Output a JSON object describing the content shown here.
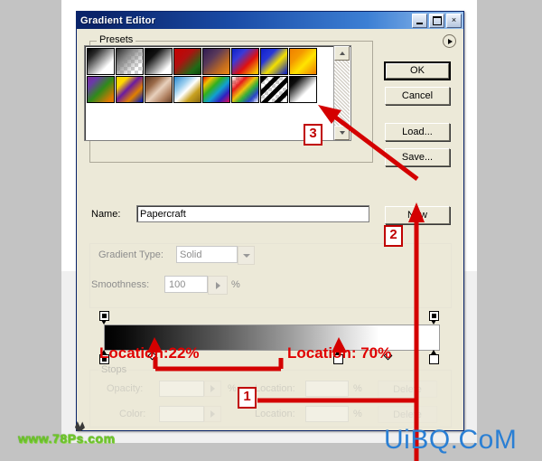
{
  "window": {
    "title": "Gradient Editor",
    "controls": {
      "minimize": "minimize-button",
      "maximize": "maximize-button",
      "close": "×"
    }
  },
  "presets": {
    "legend": "Presets",
    "menu_icon": "preset-menu-arrow-icon",
    "scroll_up": "scroll-up-arrow",
    "scroll_down": "scroll-down-arrow",
    "rows": [
      [
        {
          "name": "foreground-to-background",
          "css": "linear-gradient(135deg,#000000 0%,#2a2a2a 22%,#ffffff 72%,#ffffff 100%)",
          "checker": false
        },
        {
          "name": "foreground-to-transparent",
          "css": "linear-gradient(135deg,#2b2b2b 0%,#8a8a8a 35%,rgba(255,255,255,0) 78%)",
          "checker": true
        },
        {
          "name": "black-white",
          "css": "linear-gradient(135deg,#000000 0%,#111111 28%,#ffffff 80%,#ffffff 100%)",
          "checker": false
        },
        {
          "name": "red-green",
          "css": "linear-gradient(135deg,#c80000 0%,#b01010 38%,#1f6b16 78%,#0d4a0c 100%)",
          "checker": false
        },
        {
          "name": "violet-orange",
          "css": "linear-gradient(135deg,#2e1a52 0%,#5a3a5a 35%,#c06a20 72%,#f08a12 100%)",
          "checker": false
        },
        {
          "name": "blue-red-yellow",
          "css": "linear-gradient(135deg,#0a22c8 0%,#3a3ad8 28%,#e01010 60%,#f5c000 92%)",
          "checker": false
        },
        {
          "name": "blue-yellow-blue",
          "css": "linear-gradient(135deg,#1020cc 0%,#2838d8 30%,#f3e000 58%,#1a2ab8 95%)",
          "checker": false
        },
        {
          "name": "orange-yellow-orange",
          "css": "linear-gradient(135deg,#f08000 0%,#f49a00 30%,#ffe400 58%,#f08800 95%)",
          "checker": false
        }
      ],
      [
        {
          "name": "violet-green-orange",
          "css": "linear-gradient(135deg,#7a2a9a 0%,#6a3aa8 20%,#2f8a1a 52%,#e07800 88%)",
          "checker": false
        },
        {
          "name": "yellow-violet-orange-blue",
          "css": "linear-gradient(135deg,#ffd400 0%,#ffd800 22%,#6a1aa0 45%,#e08000 70%,#1020b0 96%)",
          "checker": false
        },
        {
          "name": "copper",
          "css": "linear-gradient(135deg,#5a3520 0%,#9a6a48 28%,#e8d0bc 52%,#b08060 78%,#6a4228 100%)",
          "checker": false
        },
        {
          "name": "chrome",
          "css": "linear-gradient(135deg,#2a8ad0 0%,#9fd0ef 32%,#ffffff 50%,#c8a020 72%,#8a6a10 100%)",
          "checker": false
        },
        {
          "name": "spectrum",
          "css": "linear-gradient(135deg,#e01010 0%,#f0c000 18%,#30b020 38%,#10a0d0 58%,#3020c0 78%,#e01050 100%)",
          "checker": false
        },
        {
          "name": "transparent-rainbow",
          "css": "linear-gradient(135deg,rgba(255,255,255,0) 0%,rgba(230,20,20,.95) 28%,rgba(240,190,0,.95) 46%,rgba(40,170,50,.95) 62%,rgba(30,60,200,.95) 80%,rgba(255,255,255,0) 100%)",
          "checker": true
        },
        {
          "name": "transparent-stripes",
          "css": "repeating-linear-gradient(135deg,#000000 0 5px,rgba(255,255,255,0) 5px 10px)",
          "checker": true
        },
        {
          "name": "papercraft-new-swatch",
          "css": "linear-gradient(135deg,#000000 0%,#0c0c0c 20%,#ffffff 62%,#ffffff 100%)",
          "checker": false
        }
      ]
    ]
  },
  "buttons": {
    "ok": "OK",
    "cancel": "Cancel",
    "load": "Load...",
    "save": "Save...",
    "new": "New"
  },
  "name_field": {
    "label": "Name:",
    "value": "Papercraft"
  },
  "gradient_type": {
    "label": "Gradient Type:",
    "value": "Solid",
    "dropdown_icon": "chevron-down-icon"
  },
  "smoothness": {
    "label": "Smoothness:",
    "value": "100",
    "unit": "%",
    "spinner_icon": "play-arrow-icon"
  },
  "ramp": {
    "css": "linear-gradient(to right,#000000 0%,#0a0a0a 6%,#5b5b5b 35%,#9b9b9b 55%,#e2e2e2 74%,#ffffff 82%,#ffffff 100%)",
    "opacity_stops": [
      {
        "name": "opacity-stop-left",
        "position_pct": 0
      },
      {
        "name": "opacity-stop-right",
        "position_pct": 100
      }
    ],
    "color_stops": [
      {
        "name": "color-stop-black",
        "position_pct": 0
      },
      {
        "name": "color-stop-mid",
        "position_pct": 70
      },
      {
        "name": "color-stop-white",
        "position_pct": 100
      }
    ],
    "midpoints": [
      {
        "name": "midpoint-diamond-left",
        "position_pct": 22
      },
      {
        "name": "midpoint-diamond-right",
        "position_pct": 85
      }
    ]
  },
  "stops_panel": {
    "legend": "Stops",
    "opacity_label": "Opacity:",
    "opacity_value": "",
    "opacity_unit": "%",
    "opacity_location_label": "Location:",
    "opacity_location_value": "",
    "opacity_location_unit": "%",
    "opacity_delete": "Delete",
    "color_label": "Color:",
    "color_value": "",
    "color_location_label": "Location:",
    "color_location_value": "",
    "color_location_unit": "%",
    "color_delete": "Delete"
  },
  "annotations": {
    "badge_1": "1",
    "badge_2": "2",
    "badge_3": "3",
    "location_left": "Location:22%",
    "location_right": "Location: 70%",
    "arrow_to_preset": "red-arrow-pointing-to-new-preset",
    "arrow_to_new_button": "red-arrow-pointing-to-new-button",
    "color": "#d40000"
  },
  "watermarks": {
    "left": "www.78Ps.com",
    "right": "UiBQ.CoM"
  }
}
